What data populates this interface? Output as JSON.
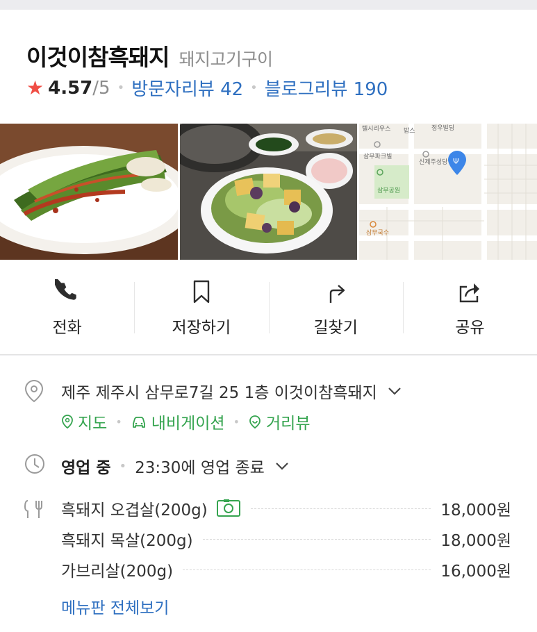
{
  "place": {
    "name": "이것이참흑돼지",
    "category": "돼지고기구이",
    "rating": "4.57",
    "rating_max": "/5",
    "visitor_reviews": "방문자리뷰 42",
    "blog_reviews": "블로그리뷰 190"
  },
  "colors": {
    "accent_blue": "#2e6fc0",
    "accent_green": "#35a44f",
    "star_red": "#f04e45",
    "map_pin_blue": "#3d86e8"
  },
  "actions": [
    {
      "label": "전화",
      "icon": "phone-icon"
    },
    {
      "label": "저장하기",
      "icon": "bookmark-icon"
    },
    {
      "label": "길찾기",
      "icon": "directions-icon"
    },
    {
      "label": "공유",
      "icon": "share-icon"
    }
  ],
  "map_labels": [
    "텔시리우스",
    "밥스",
    "정우빌딩",
    "삼무파크빌",
    "신제주성당",
    "삼무공원",
    "삼무국수"
  ],
  "address": {
    "text": "제주 제주시 삼무로7길 25 1층 이것이참흑돼지",
    "links": [
      "지도",
      "내비게이션",
      "거리뷰"
    ]
  },
  "hours": {
    "status": "영업 중",
    "detail": "23:30에 영업 종료"
  },
  "menu": {
    "items": [
      {
        "name": "흑돼지 오겹살(200g)",
        "price": "18,000원",
        "has_photo": true
      },
      {
        "name": "흑돼지 목살(200g)",
        "price": "18,000원",
        "has_photo": false
      },
      {
        "name": "가브리살(200g)",
        "price": "16,000원",
        "has_photo": false
      }
    ],
    "more": "메뉴판 전체보기"
  }
}
